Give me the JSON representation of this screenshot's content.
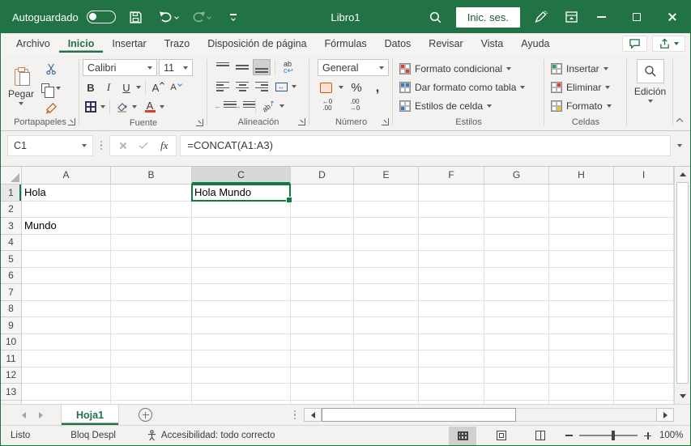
{
  "titlebar": {
    "autosave_label": "Autoguardado",
    "title": "Libro1",
    "signin_label": "Inic. ses."
  },
  "tabs": {
    "items": [
      "Archivo",
      "Inicio",
      "Insertar",
      "Trazo",
      "Disposición de página",
      "Fórmulas",
      "Datos",
      "Revisar",
      "Vista",
      "Ayuda"
    ],
    "active": "Inicio"
  },
  "ribbon": {
    "clipboard": {
      "label": "Portapapeles",
      "paste": "Pegar"
    },
    "font": {
      "label": "Fuente",
      "family": "Calibri",
      "size": "11",
      "bold": "B",
      "italic": "I",
      "underline": "U",
      "a": "A"
    },
    "alignment": {
      "label": "Alineación",
      "wrap_glyph": "ab",
      "orient_glyph": "ab"
    },
    "number": {
      "label": "Número",
      "format": "General",
      "percent": "%",
      "comma": ",",
      "inc_decimal_glyph": "←0 .00",
      "dec_decimal_glyph": ".00 →0"
    },
    "styles": {
      "label": "Estilos",
      "buttons": [
        "Formato condicional",
        "Dar formato como tabla",
        "Estilos de celda"
      ]
    },
    "cells": {
      "label": "Celdas",
      "buttons": [
        "Insertar",
        "Eliminar",
        "Formato"
      ]
    },
    "editing": {
      "label": "Edición"
    }
  },
  "formula_bar": {
    "name_box": "C1",
    "fx": "fx",
    "formula": "=CONCAT(A1:A3)"
  },
  "grid": {
    "columns": [
      "A",
      "B",
      "C",
      "D",
      "E",
      "F",
      "G",
      "H",
      "I"
    ],
    "row_count": 14,
    "cells": {
      "A1": "Hola",
      "A3": "Mundo",
      "C1": "Hola Mundo"
    },
    "selected_cell": "C1",
    "selected_column": "C",
    "selected_row": 1
  },
  "sheet_bar": {
    "active_sheet": "Hoja1"
  },
  "status_bar": {
    "mode": "Listo",
    "scroll_lock": "Bloq Despl",
    "accessibility": "Accesibilidad: todo correcto",
    "zoom_level": "100%"
  },
  "colors": {
    "excel_green": "#217346",
    "selection_green": "#107C41"
  }
}
